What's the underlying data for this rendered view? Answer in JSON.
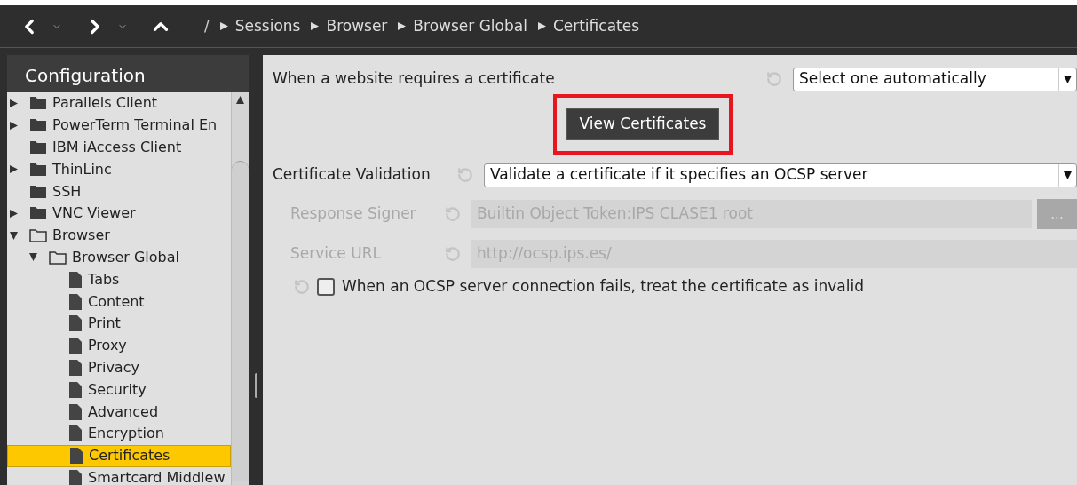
{
  "toolbar": {
    "breadcrumb_root": "/",
    "breadcrumbs": [
      "Sessions",
      "Browser",
      "Browser Global",
      "Certificates"
    ]
  },
  "sidebar": {
    "title": "Configuration",
    "tree": [
      {
        "label": "Parallels Client",
        "kind": "folder",
        "expandable": true,
        "expanded": false,
        "selected": false
      },
      {
        "label": "PowerTerm Terminal En",
        "kind": "folder",
        "expandable": true,
        "expanded": false,
        "selected": false
      },
      {
        "label": "IBM iAccess Client",
        "kind": "folder",
        "expandable": false,
        "expanded": false,
        "selected": false
      },
      {
        "label": "ThinLinc",
        "kind": "folder",
        "expandable": true,
        "expanded": false,
        "selected": false
      },
      {
        "label": "SSH",
        "kind": "folder",
        "expandable": false,
        "expanded": false,
        "selected": false
      },
      {
        "label": "VNC Viewer",
        "kind": "folder",
        "expandable": true,
        "expanded": false,
        "selected": false
      },
      {
        "label": "Browser",
        "kind": "folder",
        "expandable": true,
        "expanded": true,
        "selected": false,
        "children": [
          {
            "label": "Browser Global",
            "kind": "folder",
            "expandable": true,
            "expanded": true,
            "selected": false,
            "children": [
              {
                "label": "Tabs",
                "kind": "page",
                "selected": false
              },
              {
                "label": "Content",
                "kind": "page",
                "selected": false
              },
              {
                "label": "Print",
                "kind": "page",
                "selected": false
              },
              {
                "label": "Proxy",
                "kind": "page",
                "selected": false
              },
              {
                "label": "Privacy",
                "kind": "page",
                "selected": false
              },
              {
                "label": "Security",
                "kind": "page",
                "selected": false
              },
              {
                "label": "Advanced",
                "kind": "page",
                "selected": false
              },
              {
                "label": "Encryption",
                "kind": "page",
                "selected": false
              },
              {
                "label": "Certificates",
                "kind": "page",
                "selected": true
              },
              {
                "label": "Smartcard Middlew",
                "kind": "page",
                "selected": false
              }
            ]
          }
        ]
      }
    ]
  },
  "content": {
    "certificate_request": {
      "label": "When a website requires a certificate",
      "value": "Select one automatically"
    },
    "view_button": {
      "label": "View Certificates",
      "highlighted": true
    },
    "validation": {
      "label": "Certificate Validation",
      "value": "Validate a certificate if it specifies an OCSP server"
    },
    "response_signer": {
      "label": "Response Signer",
      "value": "Builtin Object Token:IPS CLASE1 root",
      "disabled": true,
      "browse": "..."
    },
    "service_url": {
      "label": "Service URL",
      "value": "http://ocsp.ips.es/",
      "disabled": true
    },
    "ocsp_fail": {
      "label": "When an OCSP server connection fails, treat the certificate as invalid",
      "checked": false
    }
  }
}
